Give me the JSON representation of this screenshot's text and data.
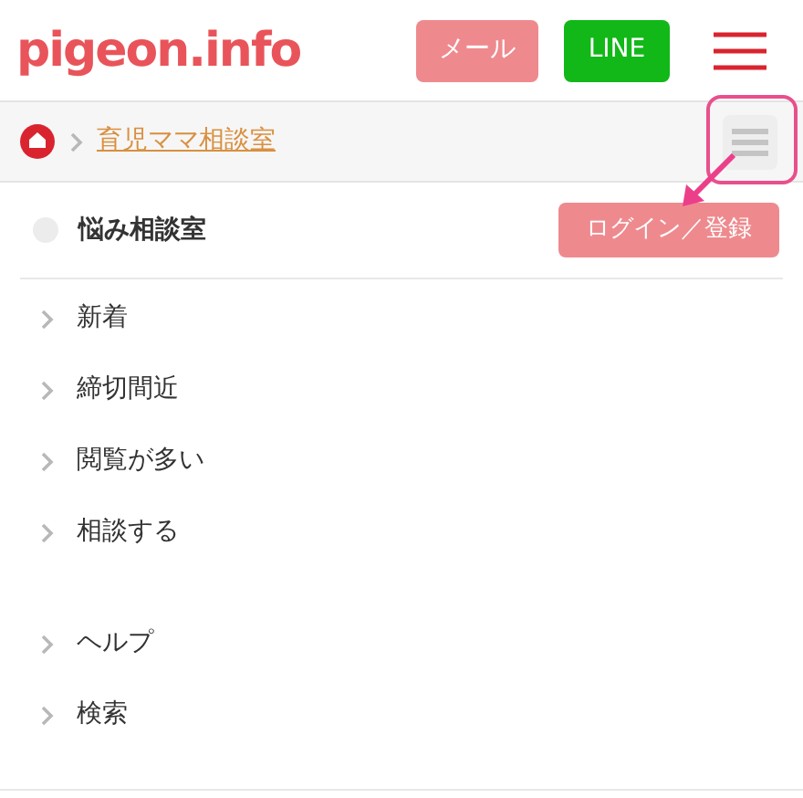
{
  "header": {
    "logo": "pigeon.info",
    "mail_button": "メール",
    "line_button": "LINE"
  },
  "breadcrumb": {
    "current": "育児ママ相談室"
  },
  "menu": {
    "title": "悩み相談室",
    "login_button": "ログイン／登録",
    "groups": [
      {
        "items": [
          "新着",
          "締切間近",
          "閲覧が多い",
          "相談する"
        ]
      },
      {
        "items": [
          "ヘルプ",
          "検索"
        ]
      }
    ]
  }
}
